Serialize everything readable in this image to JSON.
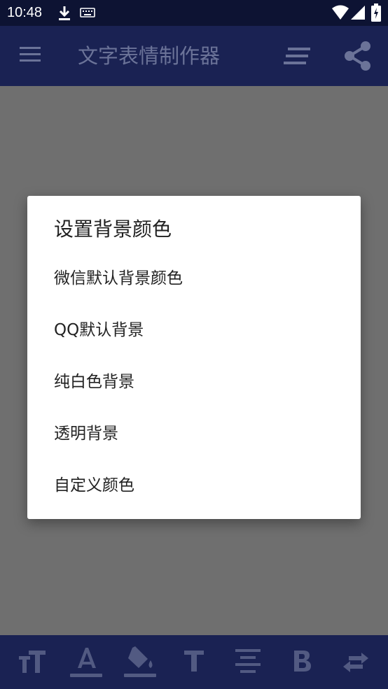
{
  "status_bar": {
    "time": "10:48",
    "icons": [
      "download-icon",
      "keyboard-icon",
      "wifi-icon",
      "signal-icon",
      "battery-icon"
    ]
  },
  "app_bar": {
    "title": "文字表情制作器",
    "icons": [
      "menu-icon",
      "align-icon",
      "share-icon"
    ]
  },
  "dialog": {
    "title": "设置背景颜色",
    "options": [
      "微信默认背景颜色",
      "QQ默认背景",
      "纯白色背景",
      "透明背景",
      "自定义颜色"
    ]
  },
  "bottom_toolbar": {
    "icons": [
      "text-size-icon",
      "text-color-icon",
      "fill-color-icon",
      "font-icon",
      "align-center-icon",
      "bold-icon",
      "swap-icon"
    ]
  },
  "colors": {
    "status_bar": "#0d1333",
    "app_bar": "#1a2253",
    "scrim": "#6f6f6f",
    "dialog": "#ffffff"
  }
}
